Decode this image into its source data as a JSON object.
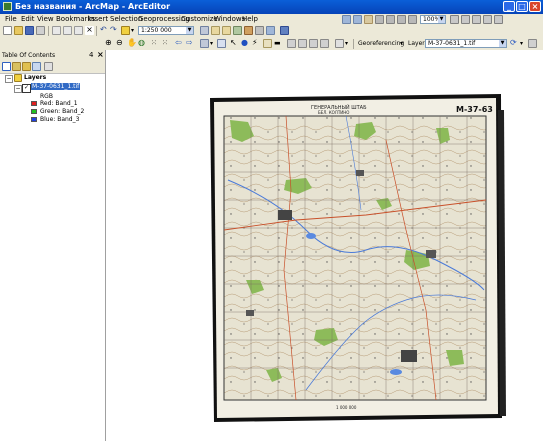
{
  "window": {
    "title": "Без названия - ArcMap - ArcEditor"
  },
  "menu": [
    "File",
    "Edit",
    "View",
    "Bookmarks",
    "Insert",
    "Selection",
    "Geoprocessing",
    "Customize",
    "Windows",
    "Help"
  ],
  "toolbar": {
    "scale": "1:250 000",
    "zoom_percent": "100%",
    "georeferencing_label": "Georeferencing",
    "layer_label": "Layer:",
    "layer_value": "M-37-0631_1.tif"
  },
  "toc": {
    "title": "Table Of Contents",
    "pin": "4",
    "close": "×",
    "layers_label": "Layers",
    "layer_name": "M-37-0631_1.tif",
    "rgb_label": "RGB",
    "bands": [
      {
        "label": "Red:   Band_1",
        "color": "#e02020"
      },
      {
        "label": "Green: Band_2",
        "color": "#20c020"
      },
      {
        "label": "Blue:  Band_3",
        "color": "#2040e0"
      }
    ]
  },
  "map": {
    "sheet_code": "M-37-63",
    "header_left": "ГЕНЕРАЛЬНЫЙ ШТАБ",
    "header_sub": "БЕЛ. КОЛТИНО",
    "header_right": "M-37-63",
    "footer": "1 000 000"
  }
}
